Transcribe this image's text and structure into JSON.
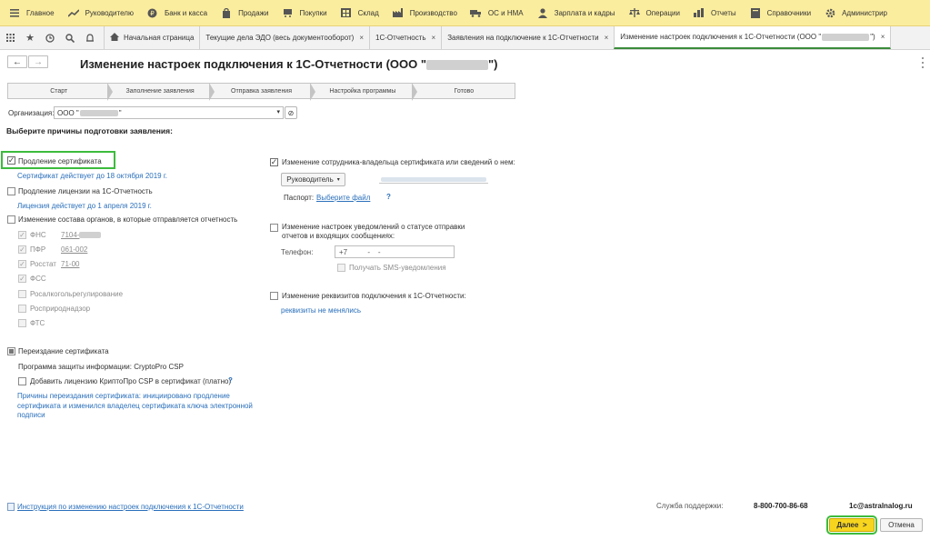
{
  "menu": [
    {
      "icon": "menu-lines-icon",
      "label": "Главное"
    },
    {
      "icon": "trend-icon",
      "label": "Руководителю"
    },
    {
      "icon": "coin-icon",
      "label": "Банк и касса"
    },
    {
      "icon": "bag-icon",
      "label": "Продажи"
    },
    {
      "icon": "cart-icon",
      "label": "Покупки"
    },
    {
      "icon": "warehouse-icon",
      "label": "Склад"
    },
    {
      "icon": "factory-icon",
      "label": "Производство"
    },
    {
      "icon": "truck-icon",
      "label": "ОС и НМА"
    },
    {
      "icon": "person-icon",
      "label": "Зарплата и кадры"
    },
    {
      "icon": "scales-icon",
      "label": "Операции"
    },
    {
      "icon": "chart-icon",
      "label": "Отчеты"
    },
    {
      "icon": "book-icon",
      "label": "Справочники"
    },
    {
      "icon": "gear-icon",
      "label": "Администрир"
    }
  ],
  "tabs": [
    {
      "label": "Начальная страница",
      "home": true
    },
    {
      "label": "Текущие дела ЭДО (весь документооборот)",
      "close": "×"
    },
    {
      "label": "1С-Отчетность",
      "close": "×"
    },
    {
      "label": "Заявления на подключение к 1С-Отчетности",
      "close": "×"
    },
    {
      "label": "Изменение настроек подключения к 1С-Отчетности (ООО \"",
      "label_tail": "\")",
      "close": "×",
      "active": true
    }
  ],
  "page": {
    "title_start": "Изменение настроек подключения к 1С-Отчетности (ООО \"",
    "title_end": "\")",
    "steps": [
      "Старт",
      "Заполнение заявления",
      "Отправка заявления",
      "Настройка программы",
      "Готово"
    ],
    "org_label": "Организация:",
    "org_value_start": "ООО \"",
    "org_value_end": "\"",
    "reasons_header": "Выберите причины подготовки заявления:"
  },
  "left": {
    "cert_renew": {
      "label": "Продление сертификата",
      "checked": true,
      "note": "Сертификат действует до 18 октября 2019 г."
    },
    "license_renew": {
      "label": "Продление лицензии на 1С-Отчетность",
      "checked": false,
      "note": "Лицензия действует до 1 апреля 2019 г."
    },
    "orgs_change": {
      "label": "Изменение состава органов, в которые отправляется отчетность",
      "checked": false
    },
    "agencies": [
      {
        "name": "ФНС",
        "code": "7104-",
        "checked": true
      },
      {
        "name": "ПФР",
        "code": "061-002",
        "checked": true
      },
      {
        "name": "Росстат",
        "code": "71-00",
        "checked": true
      },
      {
        "name": "ФСС",
        "code": "",
        "checked": true
      },
      {
        "name": "Росалкогольрегулирование",
        "code": "",
        "checked": false
      },
      {
        "name": "Росприроднадзор",
        "code": "",
        "checked": false
      },
      {
        "name": "ФТС",
        "code": "",
        "checked": false
      }
    ],
    "reissue": {
      "label": "Переиздание сертификата",
      "checked": true
    },
    "crypto_label": "Программа защиты информации:",
    "crypto_value": "CryptoPro CSP",
    "add_license": {
      "label": "Добавить лицензию КриптоПро CSP в сертификат (платно)",
      "help": "?"
    },
    "reissue_reason": "Причины переиздания сертификата: инициировано продление сертификата и изменился владелец сертификата ключа электронной подписи"
  },
  "right": {
    "owner_change": {
      "label": "Изменение сотрудника-владельца сертификата или сведений о нем:",
      "checked": true
    },
    "role_select": "Руководитель",
    "passport_label": "Паспорт:",
    "passport_link": "Выберите файл",
    "passport_help": "?",
    "notify_change": {
      "label": "Изменение настроек уведомлений о статусе отправки отчетов и входящих сообщениях:",
      "checked": false
    },
    "phone_label": "Телефон:",
    "phone_value": "+7          -    -",
    "sms_label": "Получать SMS-уведомления",
    "requisites_change": {
      "label": "Изменение реквизитов подключения к 1С-Отчетности:",
      "checked": false
    },
    "requisites_note": "реквизиты не менялись"
  },
  "footer": {
    "instruction_link": "Инструкция по изменению настроек подключения к 1С-Отчетности",
    "support_label": "Служба поддержки:",
    "support_phone": "8-800-700-86-68",
    "support_email": "1c@astralnalog.ru",
    "next_button": "Далее  >",
    "cancel_button": "Отмена"
  },
  "colors": {
    "menu_bg": "#fbed9e",
    "link": "#2a6fbb",
    "highlight": "#3dbb3d",
    "next_bg": "#f7d51e"
  }
}
